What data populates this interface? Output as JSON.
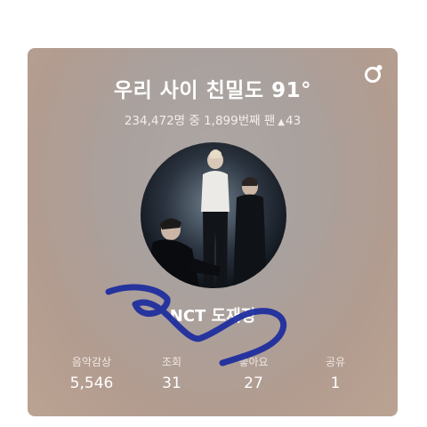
{
  "card": {
    "title": "우리 사이 친밀도 91°",
    "rank": {
      "text": "234,472명 중 1,899번째 팬",
      "change": "43"
    },
    "profile_name": "NCT 도재정",
    "stats": [
      {
        "label": "음악감상",
        "value": "5,546"
      },
      {
        "label": "조회",
        "value": "31"
      },
      {
        "label": "좋아요",
        "value": "27"
      },
      {
        "label": "공유",
        "value": "1"
      }
    ]
  },
  "icons": {
    "logo": "app-logo-icon",
    "up": "triangle-up-icon"
  },
  "colors": {
    "card_top": "#aea7a4",
    "card_bottom": "#bba392",
    "scribble": "#1a2a9e"
  }
}
